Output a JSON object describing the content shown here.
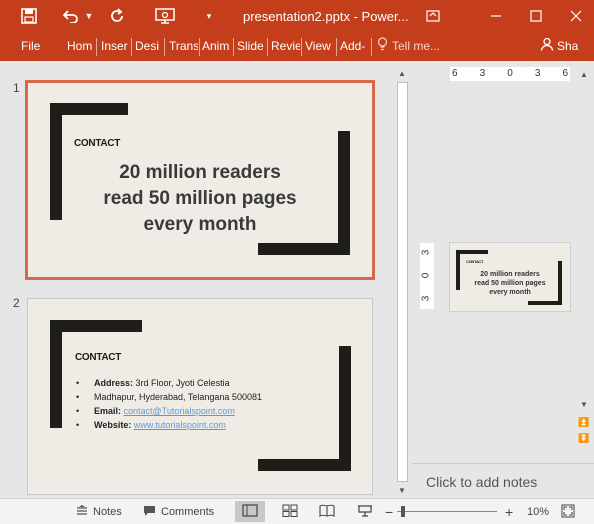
{
  "window": {
    "title": "presentation2.pptx - Power...",
    "icons": [
      "save-icon",
      "undo-icon",
      "dropdown-icon",
      "redo-icon",
      "present-icon",
      "customize-icon",
      "ribbon-display-icon",
      "minimize-icon",
      "maximize-icon",
      "close-icon"
    ]
  },
  "ribbon": {
    "tabs": [
      "File",
      "Hom",
      "Inser",
      "Desi",
      "Trans",
      "Anim",
      "Slide",
      "Revie",
      "View",
      "Add-"
    ],
    "tell_me": "Tell me...",
    "share": "Sha"
  },
  "slides": [
    {
      "number": "1",
      "heading": "CONTACT",
      "lines": [
        "20 million readers",
        "read 50 million pages",
        "every month"
      ]
    },
    {
      "number": "2",
      "heading": "CONTACT",
      "address_label": "Address:",
      "address_value": "3rd Floor, Jyoti Celestia",
      "address_line2": "Madhapur, Hyderabad, Telangana 500081",
      "email_label": "Email:",
      "email_value": "contact@Tutorialspoint.com",
      "website_label": "Website:",
      "website_value": "www.tutorialspoint.com",
      "bullet": "•"
    }
  ],
  "editor": {
    "ruler_h": [
      "6",
      "3",
      "0",
      "3",
      "6"
    ],
    "ruler_v": [
      "3",
      "0",
      "3"
    ],
    "mini_heading": "CONTACT",
    "mini_lines": [
      "20 million readers",
      "read 50 million pages",
      "every month"
    ],
    "notes_placeholder": "Click to add notes"
  },
  "status": {
    "notes_label": "Notes",
    "comments_label": "Comments",
    "zoom_minus": "−",
    "zoom_plus": "+",
    "zoom_level": "10%",
    "zoom_fraction": 0.1
  },
  "colors": {
    "accent": "#c43e1c",
    "selected_border": "#d86a4c",
    "slide_bg": "#efece5",
    "bar": "#1e1d18"
  }
}
